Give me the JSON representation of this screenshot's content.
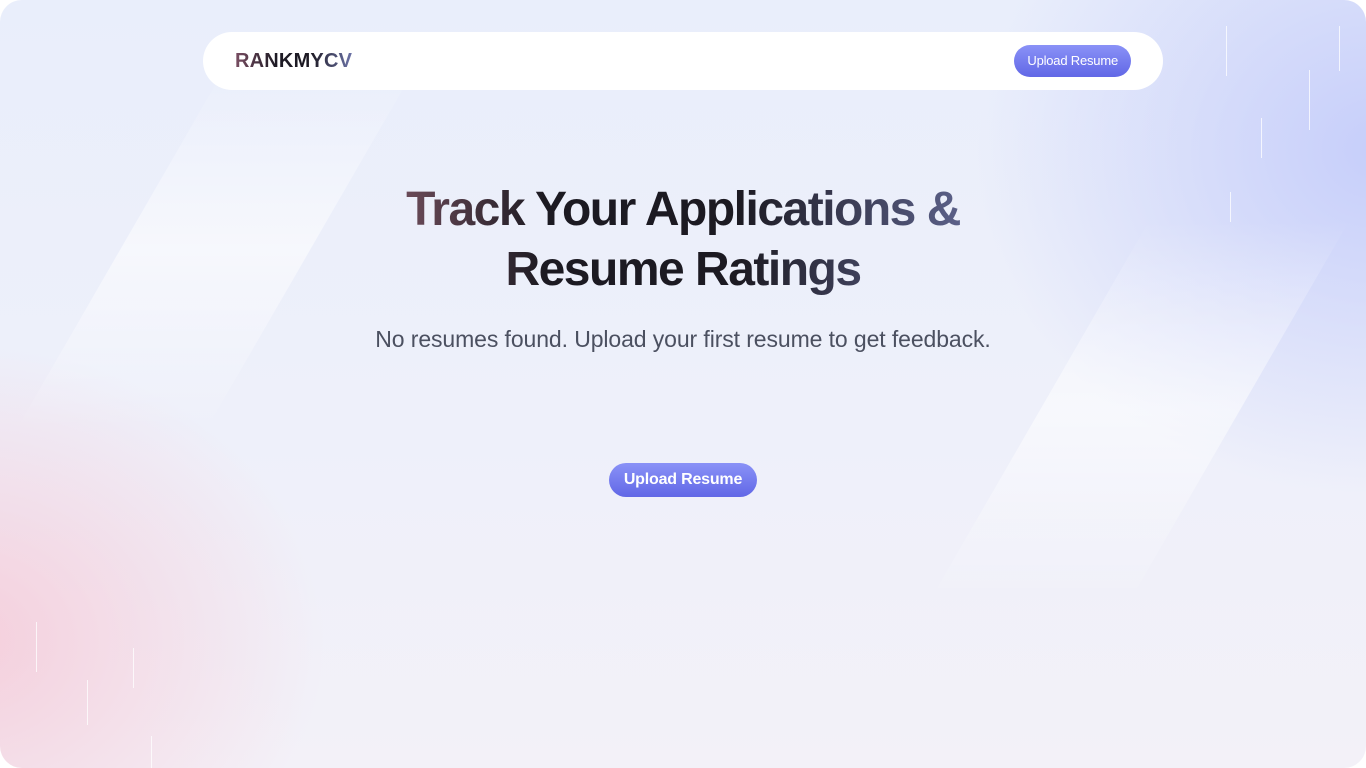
{
  "brand": {
    "name": "RANKMYCV"
  },
  "navbar": {
    "upload_label": "Upload Resume"
  },
  "hero": {
    "title_line1": "Track Your Applications &",
    "title_line2": "Resume Ratings",
    "subtitle": "No resumes found. Upload your first resume to get feedback."
  },
  "cta": {
    "upload_label": "Upload Resume"
  },
  "colors": {
    "accent": "#6c73ee",
    "background": "#eceffa",
    "text_dark": "#1c1a22",
    "text_muted": "#4b5060"
  }
}
